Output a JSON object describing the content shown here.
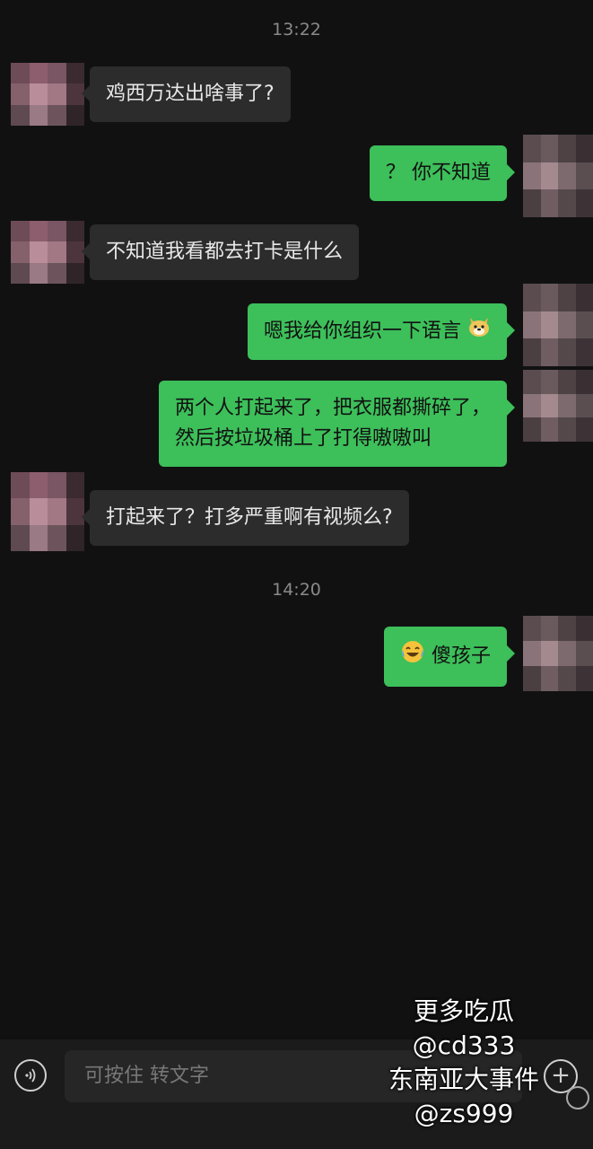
{
  "timestamps": [
    "13:22",
    "14:20"
  ],
  "messages": [
    {
      "from": "other",
      "text": "鸡西万达出啥事了?"
    },
    {
      "from": "me",
      "text": "？ 你不知道"
    },
    {
      "from": "other",
      "text": "不知道我看都去打卡是什么"
    },
    {
      "from": "me",
      "text": "嗯我给你组织一下语言",
      "emoji": "doge-emoji"
    },
    {
      "from": "me",
      "lines": [
        "两个人打起来了，把衣服都撕碎了，",
        "然后按垃圾桶上了打得嗷嗷叫"
      ]
    },
    {
      "from": "other",
      "text": "打起来了？打多严重啊有视频么?"
    },
    {
      "from": "me",
      "text": "傻孩子",
      "emoji": "laugh-cry-emoji"
    }
  ],
  "input_bar": {
    "placeholder": "可按住 转文字",
    "voice_icon": "voice-icon",
    "plus_icon": "plus-icon"
  },
  "watermark": {
    "lines": [
      "更多吃瓜",
      "@cd333",
      "东南亚大事件",
      "@zs999"
    ]
  },
  "colors": {
    "background": "#111111",
    "incoming_bubble": "#2c2c2c",
    "outgoing_bubble": "#3dbf5a"
  }
}
